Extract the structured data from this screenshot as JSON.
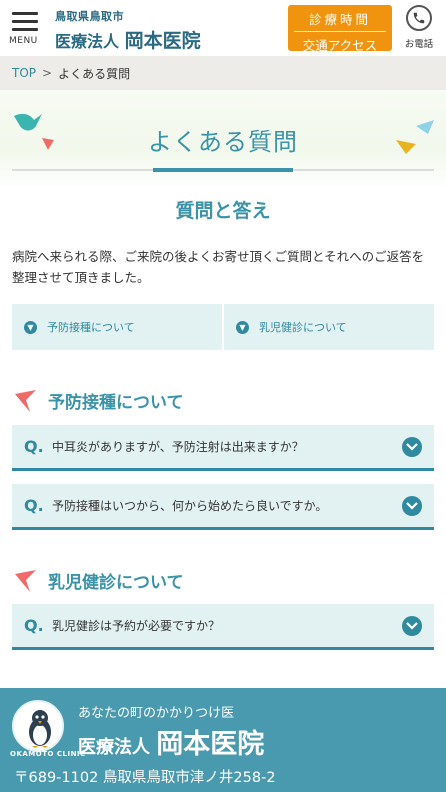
{
  "header": {
    "menu_label": "MENU",
    "logo_sub": "鳥取県鳥取市",
    "logo_prefix": "医療法人",
    "logo_name": "岡本医院",
    "hours_line1": "診療時間",
    "hours_line2": "交通アクセス",
    "phone_label": "お電話"
  },
  "breadcrumb": {
    "top": "TOP",
    "separator": ">",
    "current": "よくある質問"
  },
  "hero": {
    "title": "よくある質問"
  },
  "section": {
    "heading": "質問と答え",
    "intro": "病院へ来られる際、ご来院の後よくお寄せ頂くご質問とそれへのご返答を整理させて頂きました。"
  },
  "categories": [
    {
      "label": "予防接種について"
    },
    {
      "label": "乳児健診について"
    }
  ],
  "faq_groups": [
    {
      "title": "予防接種について",
      "questions": [
        {
          "q": "Q.",
          "text": "中耳炎がありますが、予防注射は出来ますか？"
        },
        {
          "q": "Q.",
          "text": "予防接種はいつから、何から始めたら良いですか。"
        }
      ]
    },
    {
      "title": "乳児健診について",
      "questions": [
        {
          "q": "Q.",
          "text": "乳児健診は予約が必要ですか？"
        }
      ]
    }
  ],
  "footer": {
    "tagline": "あなたの町のかかりつけ医",
    "name_prefix": "医療法人",
    "name": "岡本医院",
    "address": "〒689-1102 鳥取県鳥取市津ノ井258-2",
    "emblem_text": "OKAMOTO CLINIC"
  },
  "colors": {
    "accent": "#3a93a8",
    "accent_dark": "#2f8aa0",
    "orange": "#f0940f",
    "light_panel": "#e2f1f1",
    "footer_bg": "#4a9aaf",
    "bird_pink": "#f06a6a"
  },
  "icons": {
    "menu": "hamburger-icon",
    "phone": "phone-icon",
    "category_chevron": "chevron-down-circle-icon",
    "heading_bird": "bird-icon",
    "question_toggle": "chevron-down-circle-icon"
  }
}
